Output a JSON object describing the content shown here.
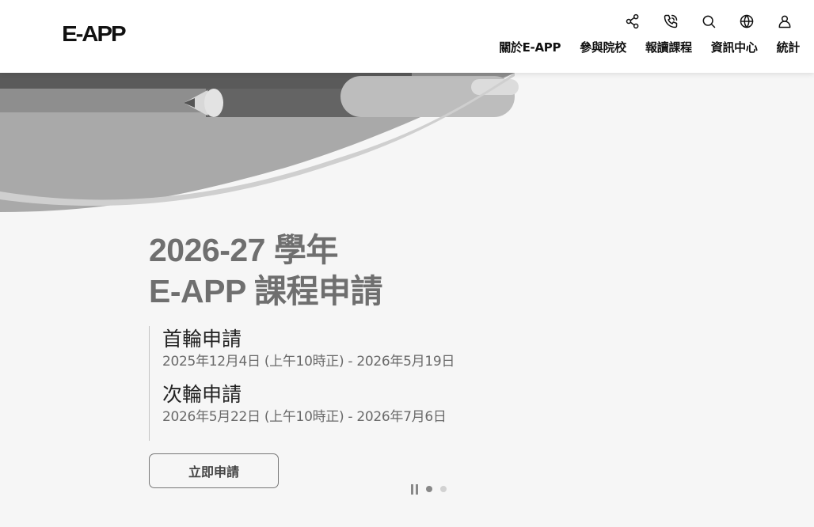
{
  "header": {
    "logo": "E-APP",
    "icons": [
      "share-icon",
      "phone-icon",
      "search-icon",
      "globe-icon",
      "user-icon"
    ],
    "nav": [
      "關於E-APP",
      "參與院校",
      "報讀課程",
      "資訊中心",
      "統計"
    ]
  },
  "hero": {
    "title_line1": "2026-27 學年",
    "title_line2": "E-APP  課程申請",
    "rounds": [
      {
        "name": "首輪申請",
        "date": "2025年12月4日 (上午10時正) - 2026年5月19日"
      },
      {
        "name": "次輪申請",
        "date": "2026年5月22日 (上午10時正) - 2026年7月6日"
      }
    ],
    "apply_label": "立即申請"
  },
  "pager": {
    "total_slides": 2,
    "active_slide": 1,
    "paused": false
  },
  "colors": {
    "title": "#6f6f6f",
    "text": "#222222",
    "muted": "#6a6a6a",
    "background": "#f6f6f6"
  }
}
